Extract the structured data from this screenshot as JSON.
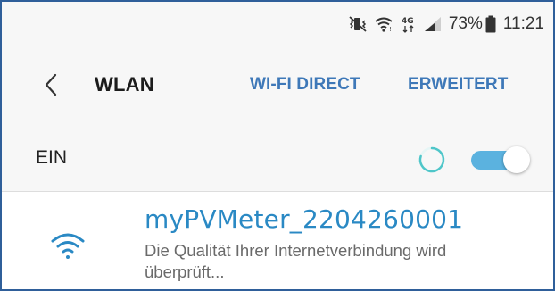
{
  "status_bar": {
    "battery_percent": "73%",
    "time": "11:21",
    "network_type": "4G"
  },
  "header": {
    "title": "WLAN",
    "tabs": [
      "WI-FI DIRECT",
      "ERWEITERT"
    ]
  },
  "wifi_toggle": {
    "label": "EIN",
    "state": "on"
  },
  "networks": [
    {
      "name": "myPVMeter_2204260001",
      "status": "Die Qualität Ihrer Internetverbindung wird überprüft..."
    }
  ],
  "colors": {
    "accent": "#3e78b8",
    "network_name": "#2a89c4",
    "switch_on": "#5bb2df",
    "spinner": "#4fc6c9",
    "frame_border": "#2f5f9a"
  }
}
